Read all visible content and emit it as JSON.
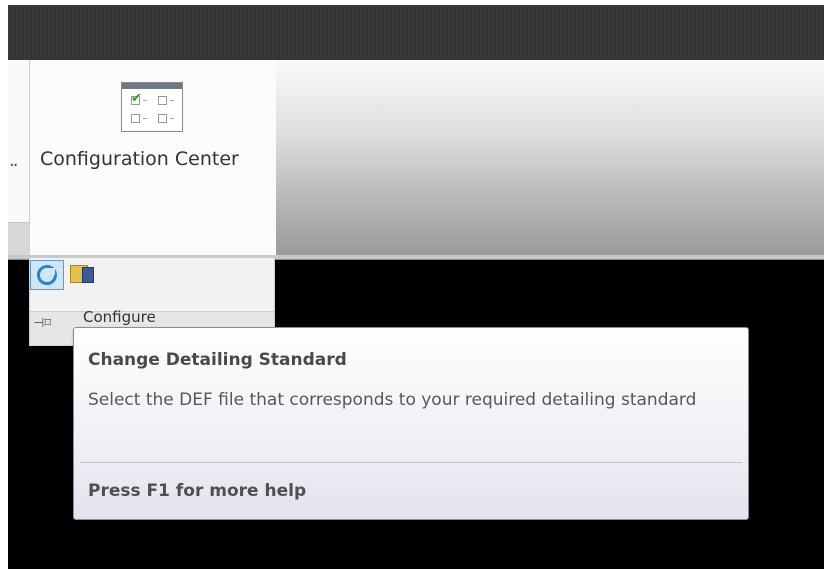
{
  "ribbon": {
    "truncated_label": "..",
    "configuration_center": {
      "label": "Configuration Center",
      "icon": "configuration-center-icon"
    }
  },
  "toolbar": {
    "buttons": [
      {
        "icon": "change-detailing-standard-icon",
        "state": "hover"
      },
      {
        "icon": "settings-config-icon"
      }
    ]
  },
  "panel": {
    "title": "Configure",
    "pin_icon": "pin-icon"
  },
  "tooltip": {
    "title": "Change Detailing Standard",
    "description": "Select the DEF file that corresponds to your required detailing standard",
    "help": "Press F1 for more help"
  },
  "colors": {
    "background": "#000000",
    "hover_button": "#cfe6f7",
    "hover_border": "#5f9ad1"
  }
}
